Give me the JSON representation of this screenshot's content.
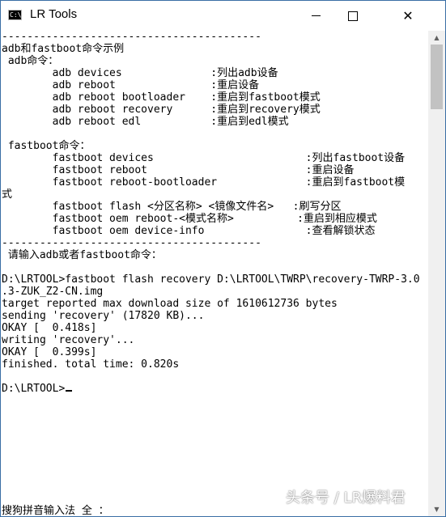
{
  "window": {
    "title": "LR Tools",
    "icon": "console-icon",
    "controls": {
      "minimize": "minimize-icon",
      "maximize": "maximize-icon",
      "close": "close-icon"
    }
  },
  "console": {
    "lines": [
      "-----------------------------------------",
      "adb和fastboot命令示例",
      " adb命令：",
      "        adb devices              :列出adb设备",
      "        adb reboot               :重启设备",
      "        adb reboot bootloader    :重启到fastboot模式",
      "        adb reboot recovery      :重启到recovery模式",
      "        adb reboot edl           :重启到edl模式",
      "",
      " fastboot命令：",
      "        fastboot devices                        :列出fastboot设备",
      "        fastboot reboot                         :重启设备",
      "        fastboot reboot-bootloader              :重启到fastboot模",
      "式",
      "        fastboot flash <分区名称> <镜像文件名>   :刷写分区",
      "        fastboot oem reboot-<模式名称>          :重启到相应模式",
      "        fastboot oem device-info                :查看解锁状态",
      "-----------------------------------------",
      " 请输入adb或者fastboot命令：",
      "",
      "D:\\LRTOOL>fastboot flash recovery D:\\LRTOOL\\TWRP\\recovery-TWRP-3.0",
      ".3-ZUK_Z2-CN.img",
      "target reported max download size of 1610612736 bytes",
      "sending 'recovery' (17820 KB)...",
      "OKAY [  0.418s]",
      "writing 'recovery'...",
      "OKAY [  0.399s]",
      "finished. total time: 0.820s",
      "",
      "D:\\LRTOOL>"
    ],
    "ime_status": "搜狗拼音输入法 全 ："
  },
  "scrollbar": {
    "up": "scroll-up-arrow-icon",
    "down": "scroll-down-arrow-icon"
  },
  "watermark": "头条号 / LR爆料君"
}
